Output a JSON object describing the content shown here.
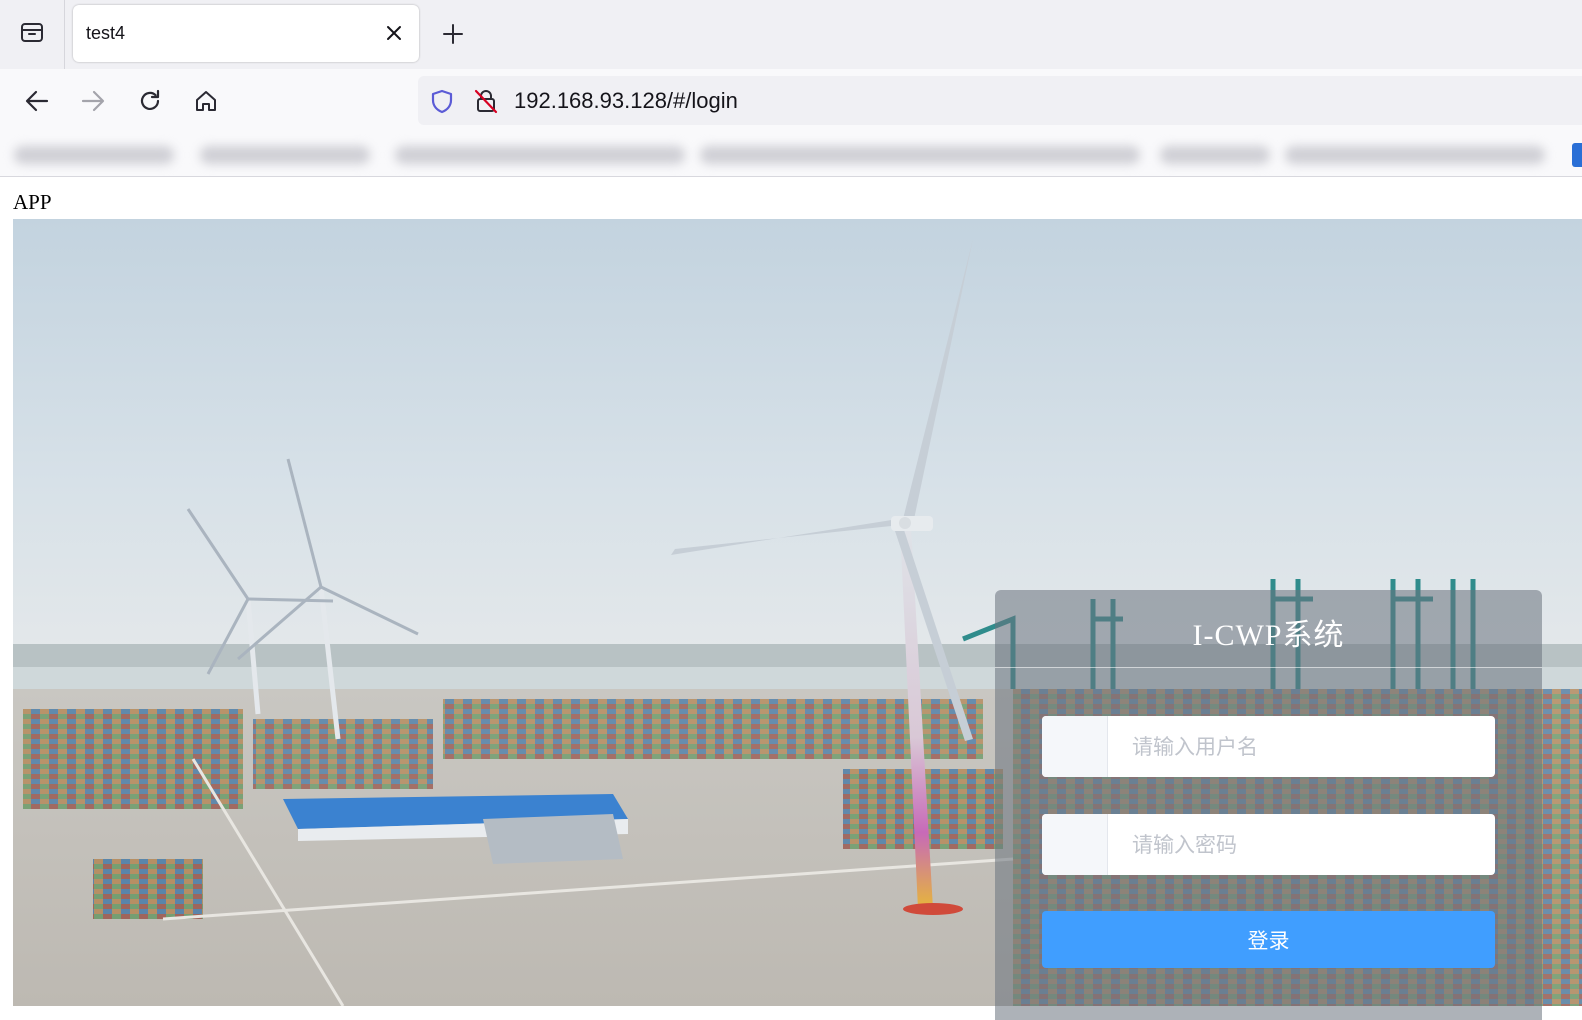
{
  "browser": {
    "tab_title": "test4",
    "url": "192.168.93.128/#/login"
  },
  "page": {
    "app_label": "APP"
  },
  "login": {
    "title": "I-CWP系统",
    "username_placeholder": "请输入用户名",
    "password_placeholder": "请输入密码",
    "submit_label": "登录"
  },
  "colors": {
    "primary_button": "#409eff",
    "browser_chrome": "#f0f0f4",
    "shield_icon": "#5b5bd6",
    "insecure_icon": "#d70022"
  }
}
